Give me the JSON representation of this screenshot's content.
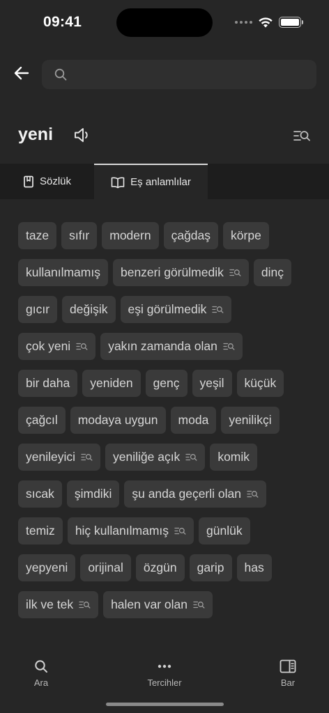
{
  "status": {
    "time": "09:41"
  },
  "search": {
    "value": "",
    "placeholder": ""
  },
  "word": "yeni",
  "tabs": [
    {
      "label": "Sözlük",
      "icon": "book-icon",
      "active": false
    },
    {
      "label": "Eş anlamlılar",
      "icon": "open-book-icon",
      "active": true
    }
  ],
  "synonyms": [
    {
      "text": "taze",
      "search": false
    },
    {
      "text": "sıfır",
      "search": false
    },
    {
      "text": "modern",
      "search": false
    },
    {
      "text": "çağdaş",
      "search": false
    },
    {
      "text": "körpe",
      "search": false
    },
    {
      "text": "kullanılmamış",
      "search": false
    },
    {
      "text": "benzeri görülmedik",
      "search": true
    },
    {
      "text": "dinç",
      "search": false
    },
    {
      "text": "gıcır",
      "search": false
    },
    {
      "text": "değişik",
      "search": false
    },
    {
      "text": "eşi görülmedik",
      "search": true
    },
    {
      "text": "çok yeni",
      "search": true
    },
    {
      "text": "yakın zamanda olan",
      "search": true
    },
    {
      "text": "bir daha",
      "search": false
    },
    {
      "text": "yeniden",
      "search": false
    },
    {
      "text": "genç",
      "search": false
    },
    {
      "text": "yeşil",
      "search": false
    },
    {
      "text": "küçük",
      "search": false
    },
    {
      "text": "çağcıl",
      "search": false
    },
    {
      "text": "modaya uygun",
      "search": false
    },
    {
      "text": "moda",
      "search": false
    },
    {
      "text": "yenilikçi",
      "search": false
    },
    {
      "text": "yenileyici",
      "search": true
    },
    {
      "text": "yeniliğe açık",
      "search": true
    },
    {
      "text": "komik",
      "search": false
    },
    {
      "text": "sıcak",
      "search": false
    },
    {
      "text": "şimdiki",
      "search": false
    },
    {
      "text": "şu anda geçerli olan",
      "search": true
    },
    {
      "text": "temiz",
      "search": false
    },
    {
      "text": "hiç kullanılmamış",
      "search": true
    },
    {
      "text": "günlük",
      "search": false
    },
    {
      "text": "yepyeni",
      "search": false
    },
    {
      "text": "orijinal",
      "search": false
    },
    {
      "text": "özgün",
      "search": false
    },
    {
      "text": "garip",
      "search": false
    },
    {
      "text": "has",
      "search": false
    },
    {
      "text": "ilk ve tek",
      "search": true
    },
    {
      "text": "halen var olan",
      "search": true
    }
  ],
  "nav": {
    "search_label": "Ara",
    "prefs_label": "Tercihler",
    "bar_label": "Bar"
  },
  "colors": {
    "background": "#262626",
    "tab_bar": "#1d1d1d",
    "chip": "#3a3a3a",
    "search_field": "#2f2f2f"
  }
}
